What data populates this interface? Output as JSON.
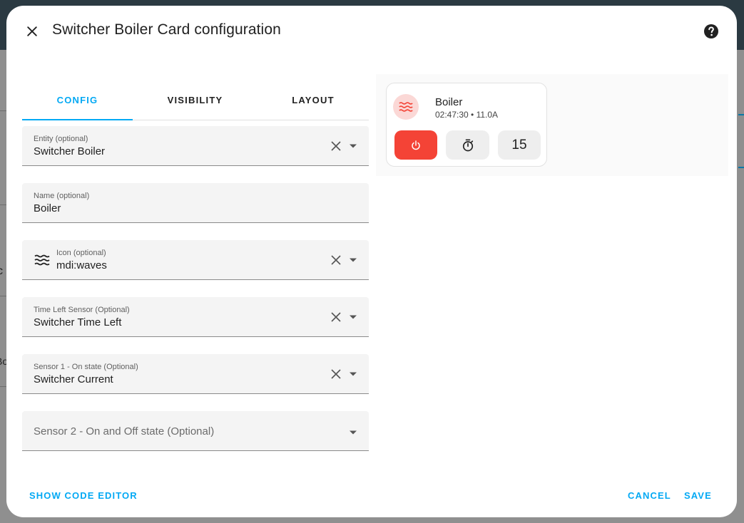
{
  "background": {
    "fragments": [
      "c",
      "Bo"
    ]
  },
  "dialog": {
    "title": "Switcher Boiler Card configuration",
    "close_icon": "close-icon",
    "help_icon": "help-circle-icon"
  },
  "tabs": [
    {
      "label": "CONFIG",
      "active": true
    },
    {
      "label": "VISIBILITY",
      "active": false
    },
    {
      "label": "LAYOUT",
      "active": false
    }
  ],
  "fields": {
    "entity": {
      "label": "Entity (optional)",
      "value": "Switcher Boiler"
    },
    "name": {
      "label": "Name (optional)",
      "value": "Boiler"
    },
    "icon": {
      "label": "Icon (optional)",
      "value": "mdi:waves",
      "icon": "waves-icon"
    },
    "time_left": {
      "label": "Time Left Sensor (Optional)",
      "value": "Switcher Time Left"
    },
    "sensor1": {
      "label": "Sensor 1 - On state (Optional)",
      "value": "Switcher Current"
    },
    "sensor2": {
      "placeholder": "Sensor 2 - On and Off state (Optional)"
    }
  },
  "preview": {
    "card": {
      "name": "Boiler",
      "state": "02:47:30 • 11.0A",
      "icon": "waves-icon",
      "buttons": {
        "power_icon": "power-icon",
        "timer_icon": "timer-icon",
        "minutes": "15"
      }
    }
  },
  "footer": {
    "code_editor": "SHOW CODE EDITOR",
    "cancel": "CANCEL",
    "save": "SAVE"
  },
  "colors": {
    "accent": "#03a9f4",
    "power": "#f44336",
    "icon_bg": "#fbd8d6"
  }
}
